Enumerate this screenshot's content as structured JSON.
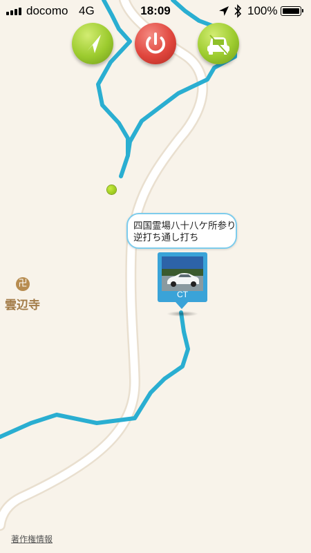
{
  "status_bar": {
    "carrier": "docomo",
    "network": "4G",
    "time": "18:09",
    "battery_percent": "100%",
    "battery_level": 1.0,
    "icons": [
      "signal-bars-icon",
      "location-arrow-icon",
      "bluetooth-icon",
      "battery-icon"
    ]
  },
  "toolbar": {
    "buttons": [
      {
        "name": "navigate-button",
        "icon": "compass-arrow-icon",
        "color": "#9ccb2e"
      },
      {
        "name": "power-button",
        "icon": "power-icon",
        "color": "#e0463d"
      },
      {
        "name": "drive-mode-button",
        "icon": "car-icon",
        "color": "#9ccb2e"
      }
    ]
  },
  "map": {
    "route_color": "#2aaed1",
    "road_color": "#ffffff",
    "background_color": "#f8f3ea",
    "callout": {
      "line1": "四国霊場八十八ケ所参り",
      "line2": "逆打ち通し打ち"
    },
    "photo_pin": {
      "label": "CT",
      "image": "white car photo"
    },
    "poi": {
      "icon": "temple-icon",
      "symbol": "卍",
      "name": "雲辺寺"
    },
    "attribution": "著作権情報"
  }
}
